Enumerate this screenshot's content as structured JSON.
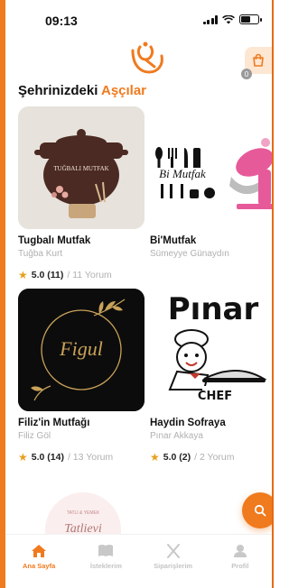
{
  "status_bar": {
    "time": "09:13"
  },
  "header": {
    "logo_icon": "chef-spoon-logo",
    "cart_icon": "shopping-bag-icon",
    "cart_count": "0"
  },
  "section": {
    "title_prefix": "Şehrinizdeki ",
    "title_accent": "Aşçılar"
  },
  "chefs": [
    {
      "name": "Tugbalı Mutfak",
      "owner": "Tuğba Kurt",
      "rating": "5.0 (11)",
      "reviews": " / 11 Yorum",
      "logo_text": "TUĞBALI MUTFAK"
    },
    {
      "name": "Bi'Mutfak",
      "owner": "Sümeyye Günaydın",
      "rating": "",
      "reviews": "",
      "logo_text": "Bi Mutfak"
    },
    {
      "name": "Filiz'in Mutfağı",
      "owner": "Filiz Göl",
      "rating": "5.0 (14)",
      "reviews": " / 13 Yorum",
      "logo_text": "Figul"
    },
    {
      "name": "Haydin Sofraya",
      "owner": "Pınar Akkaya",
      "rating": "5.0 (2)",
      "reviews": " / 2 Yorum",
      "logo_text": "Pınar",
      "logo_sub": "CHEF"
    }
  ],
  "partial_card": {
    "logo_text": "Tatlievi",
    "logo_top": "TATLI & YEMEK"
  },
  "fab": {
    "icon": "search-icon"
  },
  "nav": [
    {
      "label": "Ana Sayfa",
      "icon": "home-icon",
      "active": true
    },
    {
      "label": "İsteklerim",
      "icon": "book-icon",
      "active": false
    },
    {
      "label": "Siparişlerim",
      "icon": "cutlery-icon",
      "active": false
    },
    {
      "label": "Profil",
      "icon": "user-icon",
      "active": false
    }
  ],
  "colors": {
    "accent": "#f07a1e",
    "star": "#e6a11c",
    "muted": "#b0b0b0"
  }
}
